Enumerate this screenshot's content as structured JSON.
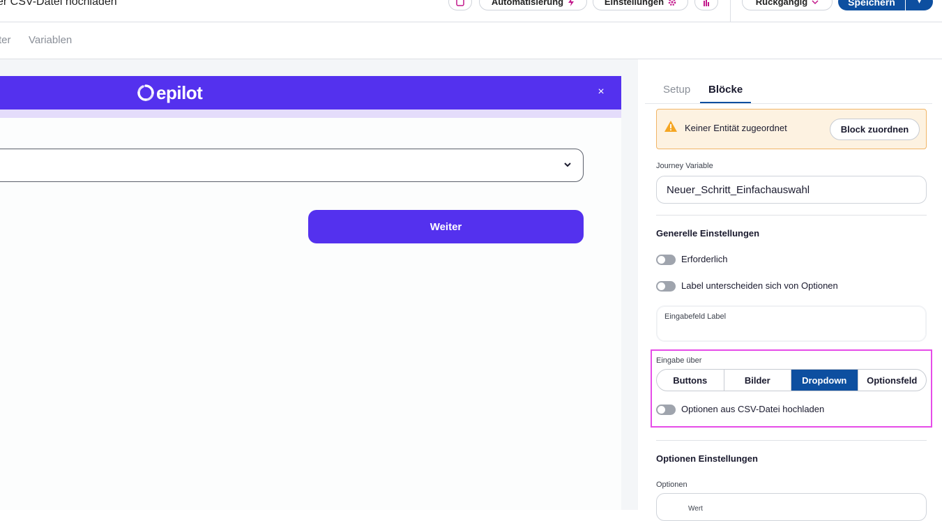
{
  "header": {
    "title": "er CSV-Datei hochladen",
    "automation_label": "Automatisierung",
    "settings_label": "Einstellungen",
    "undo_label": "Rückgängig",
    "save_label": "Speichern"
  },
  "subtabs": {
    "left_partial": "ter",
    "variables": "Variablen"
  },
  "preview": {
    "logo_text": "epilot",
    "close_symbol": "×",
    "next_button": "Weiter"
  },
  "panel": {
    "tabs": {
      "setup": "Setup",
      "blocks": "Blöcke"
    },
    "warning": {
      "text": "Keiner Entität zugeordnet",
      "button": "Block zuordnen"
    },
    "journey_variable": {
      "label": "Journey Variable",
      "value": "Neuer_Schritt_Einfachauswahl"
    },
    "general": {
      "title": "Generelle Einstellungen",
      "required": "Erforderlich",
      "label_differs": "Label unterscheiden sich von Optionen",
      "input_label": "Eingabefeld Label"
    },
    "input_via": {
      "label": "Eingabe über",
      "options": [
        "Buttons",
        "Bilder",
        "Dropdown",
        "Optionsfeld"
      ],
      "selected": "Dropdown",
      "csv_toggle": "Optionen aus CSV-Datei hochladen"
    },
    "options": {
      "title": "Optionen Einstellungen",
      "label": "Optionen",
      "value_label": "Wert"
    }
  },
  "colors": {
    "brand": "#5431ee",
    "primary": "#0d4fa0",
    "highlight": "#e64ce8",
    "warning_bg": "#fdf2e1",
    "warning_border": "#f1b566"
  }
}
